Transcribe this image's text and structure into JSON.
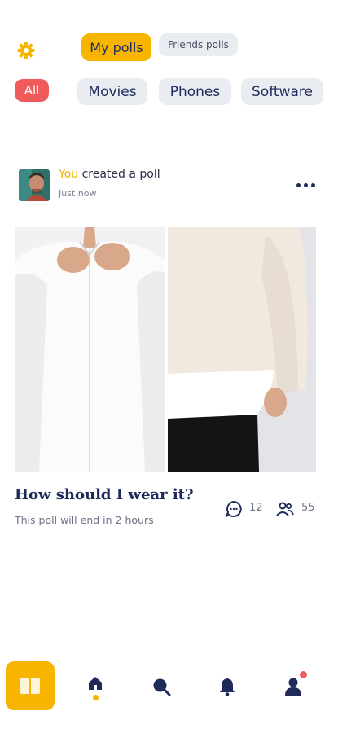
{
  "tabs": {
    "my_polls": "My polls",
    "friends_polls": "Friends polls"
  },
  "categories": [
    "All",
    "Movies",
    "Phones",
    "Software"
  ],
  "post": {
    "actor": "You",
    "action": " created a poll",
    "time": "Just now",
    "question": "How should I wear it?",
    "ends": "This poll will end in 2 hours",
    "comments": "12",
    "participants": "55"
  },
  "icons": {
    "settings": "gear-icon",
    "more": "more-icon",
    "comments": "comment-icon",
    "participants": "users-icon",
    "nav": [
      "book-icon",
      "home-icon",
      "search-icon",
      "bell-icon",
      "user-icon"
    ]
  },
  "colors": {
    "accent": "#f7b500",
    "danger": "#ef5b5b",
    "navy": "#1e2a5a",
    "chip_bg": "#e9ecf1"
  }
}
